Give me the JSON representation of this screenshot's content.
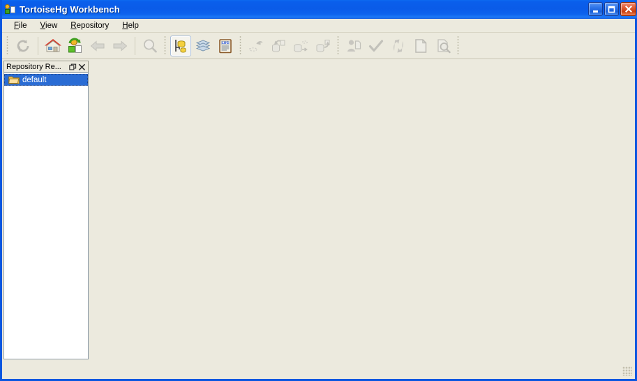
{
  "window": {
    "title": "TortoiseHg Workbench",
    "app_icon": "tortoisehg-icon",
    "caption_buttons": [
      {
        "name": "minimize",
        "label": "Minimize",
        "glyph": "minimize-icon"
      },
      {
        "name": "maximize",
        "label": "Maximize",
        "glyph": "maximize-icon"
      },
      {
        "name": "close",
        "label": "Close",
        "glyph": "close-icon"
      }
    ],
    "colors": {
      "titlebar_blue": "#0A5BE8",
      "window_face": "#ECEADE",
      "selection_blue": "#2A6CD4",
      "tree_background": "#FFFFFF"
    }
  },
  "menubar": {
    "items": [
      {
        "label": "File",
        "accel": "F"
      },
      {
        "label": "View",
        "accel": "V"
      },
      {
        "label": "Repository",
        "accel": "R"
      },
      {
        "label": "Help",
        "accel": "H"
      }
    ]
  },
  "toolbar": {
    "groups": [
      {
        "name": "navigation",
        "buttons": [
          {
            "name": "refresh",
            "icon": "refresh-icon",
            "label": "Refresh",
            "enabled": false,
            "checked": false
          },
          {
            "name": "home",
            "icon": "home-icon",
            "label": "Home",
            "enabled": true,
            "checked": false
          },
          {
            "name": "clone-repository",
            "icon": "clone-repository-icon",
            "label": "Clone Repository",
            "enabled": true,
            "checked": false
          },
          {
            "name": "back",
            "icon": "arrow-left-icon",
            "label": "Back",
            "enabled": false,
            "checked": false
          },
          {
            "name": "forward",
            "icon": "arrow-right-icon",
            "label": "Forward",
            "enabled": false,
            "checked": false
          },
          {
            "name": "filter",
            "icon": "magnifier-icon",
            "label": "Filter",
            "enabled": false,
            "checked": false
          }
        ]
      },
      {
        "name": "view-panes",
        "buttons": [
          {
            "name": "show-graph",
            "icon": "revision-graph-icon",
            "label": "Show Graph",
            "enabled": true,
            "checked": true
          },
          {
            "name": "show-filelist",
            "icon": "filelist-icon",
            "label": "Show File List",
            "enabled": true,
            "checked": false
          },
          {
            "name": "show-output-log",
            "icon": "output-log-icon",
            "label": "Show Output Log",
            "enabled": true,
            "checked": false
          }
        ]
      },
      {
        "name": "synchronize",
        "buttons": [
          {
            "name": "incoming",
            "icon": "incoming-icon",
            "label": "Incoming",
            "enabled": false,
            "checked": false
          },
          {
            "name": "pull",
            "icon": "pull-icon",
            "label": "Pull",
            "enabled": false,
            "checked": false
          },
          {
            "name": "outgoing",
            "icon": "outgoing-icon",
            "label": "Outgoing",
            "enabled": false,
            "checked": false
          },
          {
            "name": "push",
            "icon": "push-icon",
            "label": "Push",
            "enabled": false,
            "checked": false
          }
        ]
      },
      {
        "name": "repository-actions",
        "buttons": [
          {
            "name": "commit",
            "icon": "commit-user-icon",
            "label": "Commit",
            "enabled": false,
            "checked": false
          },
          {
            "name": "verify",
            "icon": "check-icon",
            "label": "Verify",
            "enabled": false,
            "checked": false
          },
          {
            "name": "update",
            "icon": "update-arrows-icon",
            "label": "Update",
            "enabled": false,
            "checked": false
          },
          {
            "name": "shelve",
            "icon": "document-icon",
            "label": "Shelve",
            "enabled": false,
            "checked": false
          },
          {
            "name": "search",
            "icon": "search-file-icon",
            "label": "Search",
            "enabled": false,
            "checked": false
          }
        ]
      }
    ]
  },
  "repository_registry": {
    "title": "Repository Re...",
    "float_button": "float-icon",
    "close_button": "close-icon",
    "tree": [
      {
        "label": "default",
        "icon": "folder-icon",
        "selected": true
      }
    ]
  },
  "statusbar": {
    "text": "",
    "resize_grip": "resize-grip-icon"
  }
}
